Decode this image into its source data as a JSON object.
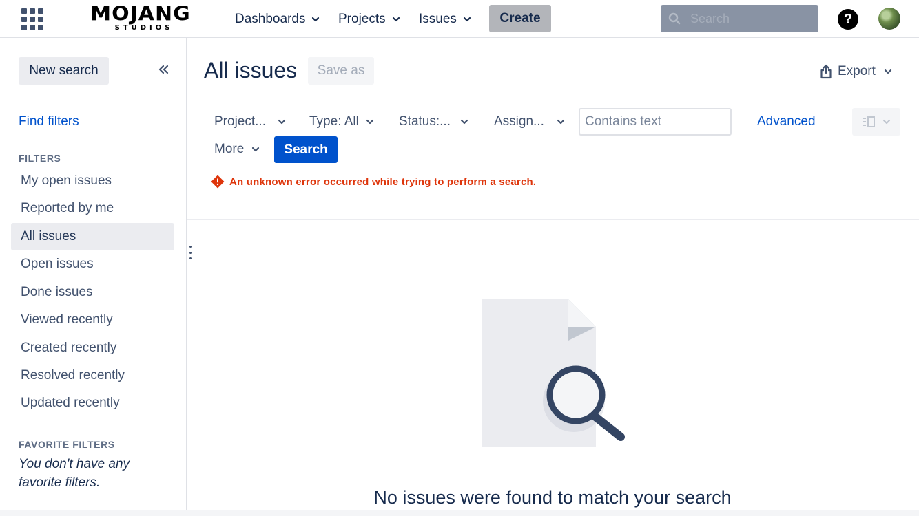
{
  "topnav": {
    "logo_text": "MOJANG",
    "logo_subtext": "STUDIOS",
    "menu": [
      {
        "label": "Dashboards"
      },
      {
        "label": "Projects"
      },
      {
        "label": "Issues"
      }
    ],
    "create_label": "Create",
    "search_placeholder": "Search",
    "help_glyph": "?"
  },
  "sidebar": {
    "new_search_label": "New search",
    "find_filters_label": "Find filters",
    "filters_heading": "FILTERS",
    "filters": [
      {
        "label": "My open issues",
        "selected": false
      },
      {
        "label": "Reported by me",
        "selected": false
      },
      {
        "label": "All issues",
        "selected": true
      },
      {
        "label": "Open issues",
        "selected": false
      },
      {
        "label": "Done issues",
        "selected": false
      },
      {
        "label": "Viewed recently",
        "selected": false
      },
      {
        "label": "Created recently",
        "selected": false
      },
      {
        "label": "Resolved recently",
        "selected": false
      },
      {
        "label": "Updated recently",
        "selected": false
      }
    ],
    "favorite_heading": "FAVORITE FILTERS",
    "favorite_empty_text": "You don't have any favorite filters."
  },
  "main": {
    "title": "All issues",
    "save_as_label": "Save as",
    "export_label": "Export",
    "filter_controls": [
      {
        "label": "Project..."
      },
      {
        "label": "Type: All"
      },
      {
        "label": "Status:..."
      },
      {
        "label": "Assign..."
      },
      {
        "label": "More"
      }
    ],
    "text_search_placeholder": "Contains text",
    "advanced_label": "Advanced",
    "search_button_label": "Search",
    "error_message": "An unknown error occurred while trying to perform a search.",
    "empty_state_message": "No issues were found to match your search"
  },
  "colors": {
    "brand_blue": "#0052CC",
    "error_red": "#DE350B",
    "text_primary": "#172B4D",
    "text_secondary": "#42526E"
  },
  "icons": [
    "app-switcher-icon",
    "chevron-down-icon",
    "search-icon",
    "help-icon",
    "collapse-sidebar-icon",
    "share-export-icon",
    "error-icon",
    "list-view-icon",
    "empty-search-illustration"
  ]
}
